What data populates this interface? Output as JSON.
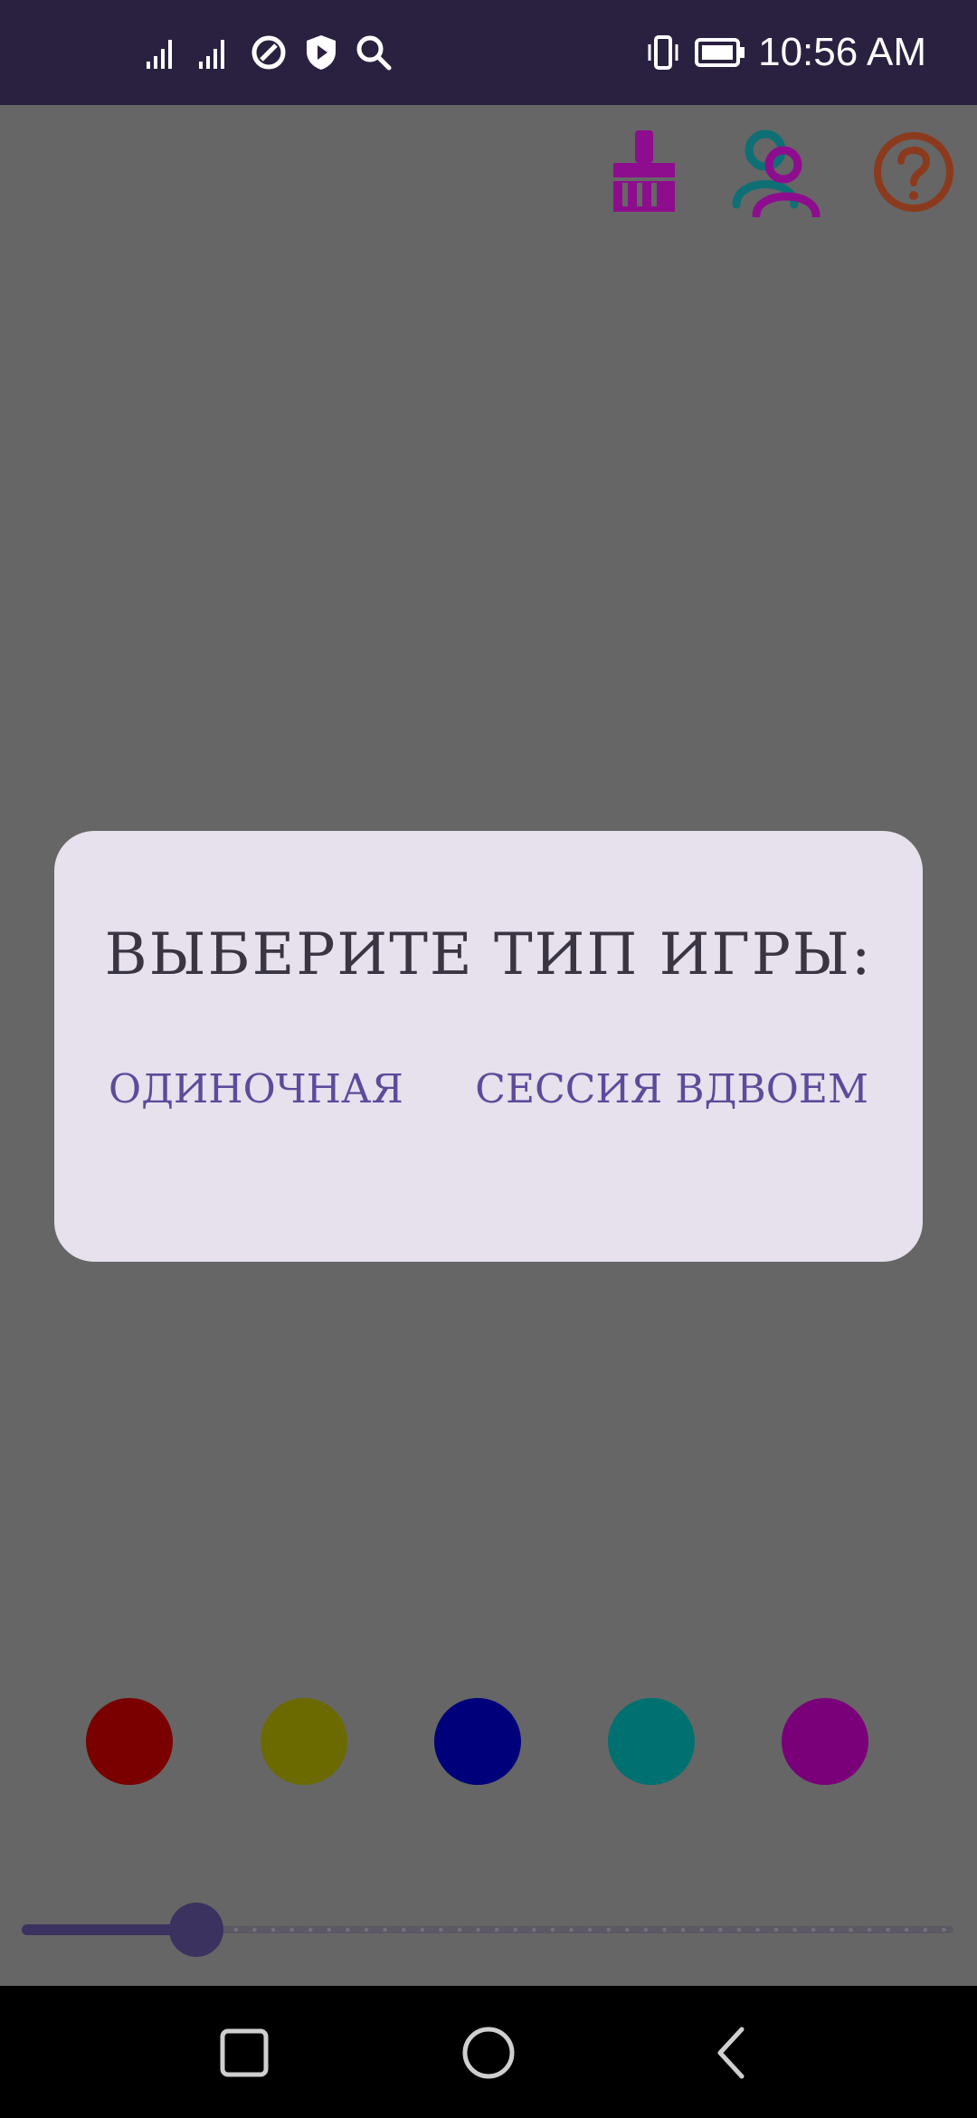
{
  "status_bar": {
    "time": "10:56 AM",
    "icons": [
      "signal-icon",
      "signal-icon",
      "data-saver-icon",
      "shield-play-icon",
      "search-icon",
      "vibrate-icon",
      "battery-icon"
    ]
  },
  "toolbar": {
    "icons": [
      {
        "name": "brush-icon",
        "color": "#8e0d8e"
      },
      {
        "name": "two-players-icon",
        "color": "#0e7075"
      },
      {
        "name": "help-icon",
        "color": "#8b3a1d"
      }
    ]
  },
  "dialog": {
    "title": "ВЫБЕРИТЕ ТИП ИГРЫ:",
    "single_label": "ОДИНОЧНАЯ",
    "duo_label": "СЕССИЯ ВДВОЕМ"
  },
  "palette": {
    "colors": [
      "#7a0000",
      "#6b6a00",
      "#00007a",
      "#007070",
      "#7a007a"
    ]
  },
  "slider": {
    "value_fraction": 0.187
  },
  "nav_bar": {
    "icons": [
      "recent-apps-icon",
      "home-icon",
      "back-icon"
    ]
  }
}
